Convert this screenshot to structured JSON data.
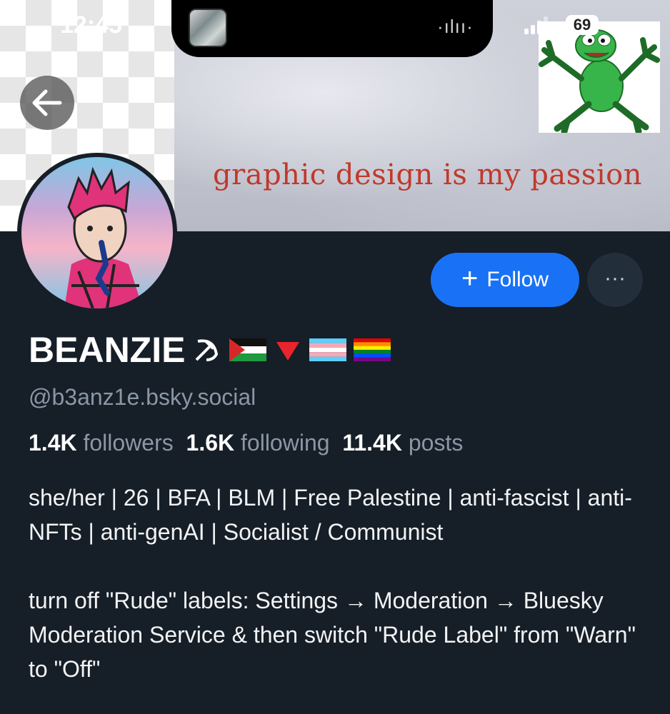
{
  "status_bar": {
    "time": "12:45",
    "battery": "69"
  },
  "banner": {
    "text": "graphic design is my passion"
  },
  "profile": {
    "display_name": "BEANZIE",
    "handle": "@b3anz1e.bsky.social",
    "stats": {
      "followers_count": "1.4K",
      "followers_label": "followers",
      "following_count": "1.6K",
      "following_label": "following",
      "posts_count": "11.4K",
      "posts_label": "posts"
    },
    "bio": "she/her | 26 | BFA | BLM | Free Palestine | anti-fascist | anti-NFTs | anti-genAI | Socialist / Communist\n\nturn off \"Rude\" labels: Settings → Moderation → Bluesky Moderation Service & then switch \"Rude Label\" from \"Warn\" to \"Off\""
  },
  "actions": {
    "follow_label": "Follow",
    "more_label": "···"
  },
  "name_emojis": [
    "hammer-and-sickle",
    "palestine-flag",
    "red-triangle",
    "trans-flag",
    "rainbow-flag"
  ],
  "colors": {
    "background": "#161e27",
    "follow_button": "#1972f5",
    "muted_text": "#8a97a6"
  }
}
